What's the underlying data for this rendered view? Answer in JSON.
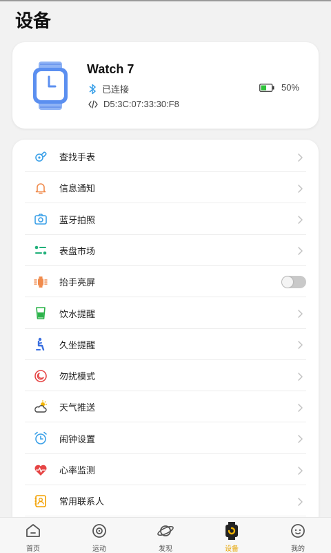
{
  "page": {
    "title": "设备"
  },
  "device": {
    "name": "Watch 7",
    "bluetooth_status": "已连接",
    "mac_address": "D5:3C:07:33:30:F8",
    "battery": "50%",
    "battery_level": 0.5
  },
  "menu": {
    "items": [
      {
        "label": "查找手表",
        "icon": "find-watch-icon",
        "color": "#3aa0e8",
        "control": "chevron"
      },
      {
        "label": "信息通知",
        "icon": "bell-icon",
        "color": "#f08a4b",
        "control": "chevron"
      },
      {
        "label": "蓝牙拍照",
        "icon": "camera-icon",
        "color": "#3aa0e8",
        "control": "chevron"
      },
      {
        "label": "表盘市场",
        "icon": "dial-market-icon",
        "color": "#21b07a",
        "control": "chevron"
      },
      {
        "label": "抬手亮屏",
        "icon": "raise-wrist-icon",
        "color": "#f08a4b",
        "control": "toggle",
        "enabled": false
      },
      {
        "label": "饮水提醒",
        "icon": "drink-water-icon",
        "color": "#2cb34a",
        "control": "chevron"
      },
      {
        "label": "久坐提醒",
        "icon": "sedentary-icon",
        "color": "#3a6fe0",
        "control": "chevron"
      },
      {
        "label": "勿扰模式",
        "icon": "do-not-disturb-icon",
        "color": "#e64545",
        "control": "chevron"
      },
      {
        "label": "天气推送",
        "icon": "weather-icon",
        "color": "#f2b400",
        "control": "chevron"
      },
      {
        "label": "闹钟设置",
        "icon": "alarm-clock-icon",
        "color": "#3aa0e8",
        "control": "chevron"
      },
      {
        "label": "心率监测",
        "icon": "heart-rate-icon",
        "color": "#e64545",
        "control": "chevron"
      },
      {
        "label": "常用联系人",
        "icon": "contacts-icon",
        "color": "#f2a000",
        "control": "chevron"
      }
    ]
  },
  "nav": {
    "items": [
      {
        "label": "首页",
        "icon": "home-icon"
      },
      {
        "label": "运动",
        "icon": "exercise-icon"
      },
      {
        "label": "发现",
        "icon": "planet-icon"
      },
      {
        "label": "设备",
        "icon": "device-icon",
        "active": true
      },
      {
        "label": "我的",
        "icon": "profile-icon"
      }
    ]
  },
  "colors": {
    "accent": "#e6a400",
    "battery": "#2fc23a",
    "watch": "#5b8ff0"
  }
}
